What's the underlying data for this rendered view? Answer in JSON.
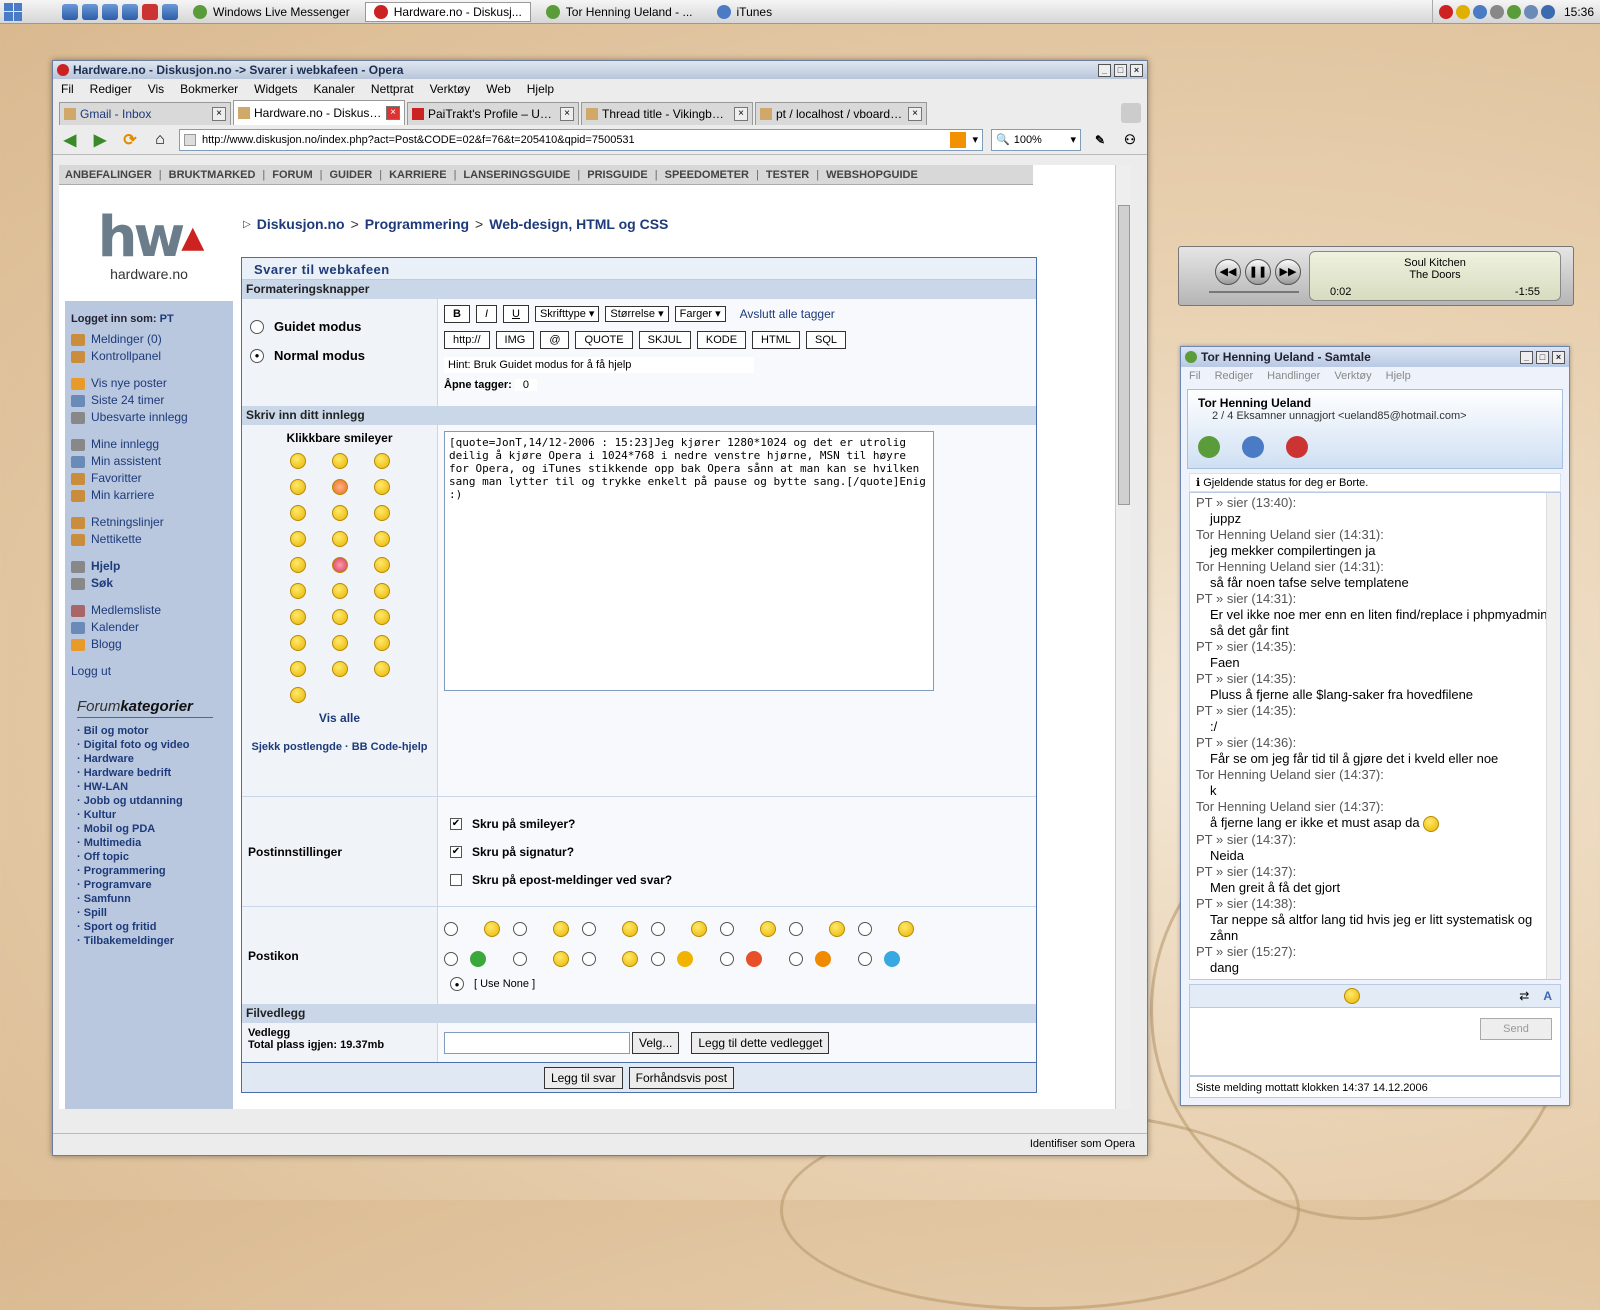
{
  "taskbar": {
    "tasks": [
      {
        "label": "Windows Live Messenger",
        "active": false
      },
      {
        "label": "Hardware.no - Diskusj...",
        "active": true
      },
      {
        "label": "Tor Henning Ueland - ...",
        "active": false
      },
      {
        "label": "iTunes",
        "active": false
      }
    ],
    "clock": "15:36"
  },
  "opera": {
    "title": "Hardware.no - Diskusjon.no -> Svarer i webkafeen - Opera",
    "menu": [
      "Fil",
      "Rediger",
      "Vis",
      "Bokmerker",
      "Widgets",
      "Kanaler",
      "Nettprat",
      "Verktøy",
      "Web",
      "Hjelp"
    ],
    "tabs": [
      {
        "label": "Gmail - Inbox",
        "active": false
      },
      {
        "label": "Hardware.no - Diskusjon...",
        "active": true
      },
      {
        "label": "PaiTrakt's Profile – Users...",
        "active": false
      },
      {
        "label": "Thread title - Vikingboard",
        "active": false
      },
      {
        "label": "pt / localhost / vboard_0...",
        "active": false
      }
    ],
    "address": "http://www.diskusjon.no/index.php?act=Post&CODE=02&f=76&t=205410&qpid=7500531",
    "zoom": "100%",
    "status": "Identifiser som Opera"
  },
  "site": {
    "topnav": [
      "ANBEFALINGER",
      "BRUKTMARKED",
      "FORUM",
      "GUIDER",
      "KARRIERE",
      "LANSERINGSGUIDE",
      "PRISGUIDE",
      "SPEEDOMETER",
      "TESTER",
      "WEBSHOPGUIDE"
    ],
    "logo_text": "hardware.no",
    "logged_in_label": "Logget inn som:",
    "logged_in_user": "PT",
    "left_links": [
      [
        "Meldinger (0)",
        "Kontrollpanel"
      ],
      [
        "Vis nye poster",
        "Siste 24 timer",
        "Ubesvarte innlegg"
      ],
      [
        "Mine innlegg",
        "Min assistent",
        "Favoritter",
        "Min karriere"
      ],
      [
        "Retningslinjer",
        "Nettikette"
      ],
      [
        "Hjelp",
        "Søk"
      ],
      [
        "Medlemsliste",
        "Kalender",
        "Blogg"
      ]
    ],
    "logout": "Logg ut",
    "forumcat_title_a": "Forum",
    "forumcat_title_b": "kategorier",
    "categories": [
      "Bil og motor",
      "Digital foto og video",
      "Hardware",
      "Hardware bedrift",
      "HW-LAN",
      "Jobb og utdanning",
      "Kultur",
      "Mobil og PDA",
      "Multimedia",
      "Off topic",
      "Programmering",
      "Programvare",
      "Samfunn",
      "Spill",
      "Sport og fritid",
      "Tilbakemeldinger"
    ],
    "breadcrumb": [
      "Diskusjon.no",
      "Programmering",
      "Web-design, HTML og CSS"
    ]
  },
  "form": {
    "title": "Svarer til webkafeen",
    "sec_format": "Formateringsknapper",
    "mode_guided": "Guidet modus",
    "mode_normal": "Normal modus",
    "btn_b": "B",
    "btn_i": "I",
    "btn_u": "U",
    "dd_font": "Skrifttype",
    "dd_size": "Størrelse",
    "dd_color": "Farger",
    "close_tags": "Avslutt alle tagger",
    "tag_buttons": [
      "http://",
      "IMG",
      "@",
      "QUOTE",
      "SKJUL",
      "KODE",
      "HTML",
      "SQL"
    ],
    "hint": "Hint: Bruk Guidet modus for å få hjelp",
    "open_tags_label": "Åpne tagger:",
    "open_tags_value": "0",
    "sec_post": "Skriv inn ditt innlegg",
    "smileys_title": "Klikkbare smileyer",
    "show_all": "Vis alle",
    "check_links": "Sjekk postlengde · BB Code-hjelp",
    "post_text": "[quote=JonT,14/12-2006 : 15:23]Jeg kjører 1280*1024 og det er utrolig deilig å kjøre Opera i 1024*768 i nedre venstre hjørne, MSN til høyre for Opera, og iTunes stikkende opp bak Opera sånn at man kan se hvilken sang man lytter til og trykke enkelt på pause og bytte sang.[/quote]Enig :)",
    "options_label": "Postinnstillinger",
    "opt_smileys": "Skru på smileyer?",
    "opt_signature": "Skru på signatur?",
    "opt_email": "Skru på epost-meldinger ved svar?",
    "icon_label": "Postikon",
    "use_none": "[ Use None ]",
    "sec_attach": "Filvedlegg",
    "attach_label": "Vedlegg",
    "space_left": "Total plass igjen: 19.37mb",
    "browse": "Velg...",
    "add_attach": "Legg til dette vedlegget",
    "submit": "Legg til svar",
    "preview": "Forhåndsvis post"
  },
  "itunes": {
    "song": "Soul Kitchen",
    "artist": "The Doors",
    "elapsed": "0:02",
    "remaining": "-1:55",
    "progress": 0.02
  },
  "msn": {
    "title": "Tor Henning Ueland - Samtale",
    "menu": [
      "Fil",
      "Rediger",
      "Handlinger",
      "Verktøy",
      "Hjelp"
    ],
    "contact_name": "Tor Henning Ueland",
    "contact_status": "2 / 4 Eksamner unnagjort <ueland85@hotmail.com>",
    "status_notice": "Gjeldende status for deg er Borte.",
    "messages": [
      {
        "who": "PT » sier (13:40):",
        "text": "juppz"
      },
      {
        "who": "Tor Henning Ueland sier (14:31):",
        "text": "jeg mekker compilertingen ja"
      },
      {
        "who": "Tor Henning Ueland sier (14:31):",
        "text": "så får noen tafse selve templatene"
      },
      {
        "who": "PT » sier (14:31):",
        "text": "Er vel ikke noe mer enn en liten find/replace i phpmyadmin, så det går fint"
      },
      {
        "who": "PT » sier (14:35):",
        "text": "Faen"
      },
      {
        "who": "PT » sier (14:35):",
        "text": "Pluss å fjerne alle $lang-saker fra hovedfilene"
      },
      {
        "who": "PT » sier (14:35):",
        "text": ":/"
      },
      {
        "who": "PT » sier (14:36):",
        "text": "Får se om jeg får tid til å gjøre det i kveld eller noe"
      },
      {
        "who": "Tor Henning Ueland sier (14:37):",
        "text": "k"
      },
      {
        "who": "Tor Henning Ueland sier (14:37):",
        "text": "å fjerne lang er ikke et must asap da"
      },
      {
        "who": "PT » sier (14:37):",
        "text": "Neida"
      },
      {
        "who": "PT » sier (14:37):",
        "text": "Men greit å få det gjort"
      },
      {
        "who": "PT » sier (14:38):",
        "text": "Tar neppe så altfor lang tid hvis jeg er litt systematisk og zånn"
      },
      {
        "who": "PT » sier (15:27):",
        "text": "dang"
      }
    ],
    "send": "Send",
    "footer": "Siste melding mottatt klokken 14:37 14.12.2006"
  }
}
